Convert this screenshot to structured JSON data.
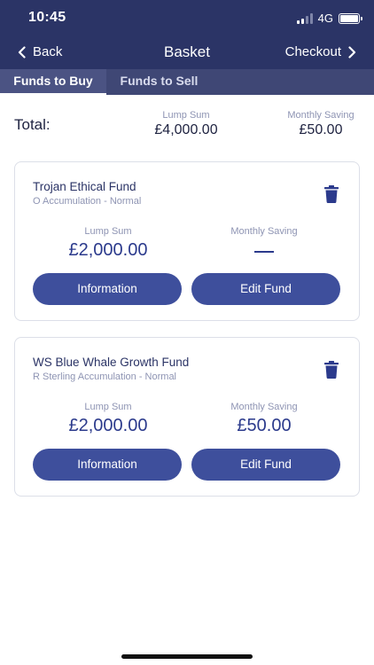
{
  "status": {
    "time": "10:45",
    "network": "4G"
  },
  "nav": {
    "back": "Back",
    "title": "Basket",
    "checkout": "Checkout"
  },
  "tabs": [
    {
      "label": "Funds to Buy",
      "active": true
    },
    {
      "label": "Funds to Sell",
      "active": false
    }
  ],
  "totals": {
    "label": "Total:",
    "lump_sum_label": "Lump Sum",
    "lump_sum_value": "£4,000.00",
    "monthly_label": "Monthly Saving",
    "monthly_value": "£50.00"
  },
  "funds": [
    {
      "name": "Trojan Ethical Fund",
      "share_class": "O Accumulation - Normal",
      "lump_sum_label": "Lump Sum",
      "lump_sum_value": "£2,000.00",
      "monthly_label": "Monthly Saving",
      "monthly_value": "",
      "info_button": "Information",
      "edit_button": "Edit Fund"
    },
    {
      "name": "WS Blue Whale Growth Fund",
      "share_class": "R Sterling Accumulation - Normal",
      "lump_sum_label": "Lump Sum",
      "lump_sum_value": "£2,000.00",
      "monthly_label": "Monthly Saving",
      "monthly_value": "£50.00",
      "info_button": "Information",
      "edit_button": "Edit Fund"
    }
  ],
  "colors": {
    "header": "#2b3466",
    "accent": "#3e4f9c",
    "value_text": "#2b3a8c"
  },
  "icons": {
    "back": "chevron-left-icon",
    "checkout": "chevron-right-icon",
    "delete": "trash-icon"
  }
}
